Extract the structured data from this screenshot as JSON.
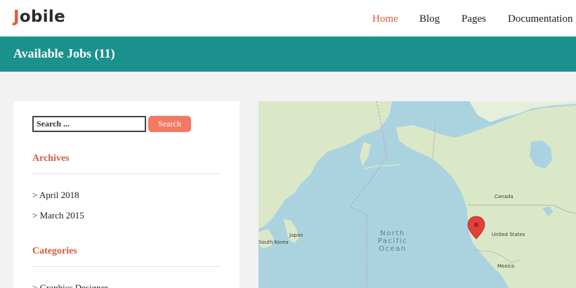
{
  "header": {
    "logo_first": "J",
    "logo_rest": "obile",
    "nav": [
      "Home",
      "Blog",
      "Pages",
      "Documentation"
    ]
  },
  "band": {
    "title": "Available Jobs (11)"
  },
  "sidebar": {
    "search": {
      "placeholder": "Search ...",
      "button": "Search"
    },
    "archives": {
      "title": "Archives",
      "items": [
        "April 2018",
        "March 2015"
      ]
    },
    "categories": {
      "title": "Categories",
      "items": [
        "Graphics Designer"
      ]
    },
    "bullet": ">"
  },
  "map": {
    "labels": {
      "canada": "Canada",
      "united_states": "United States",
      "mexico": "Mexico",
      "japan": "Japan",
      "south_korea": "South Korea",
      "ocean_line1": "North",
      "ocean_line2": "Pacific",
      "ocean_line3": "Ocean"
    }
  },
  "colors": {
    "accent": "#d45a3f",
    "band": "#1b918d",
    "button": "#f27a63",
    "water": "#aad3df",
    "land": "#dbe8c8",
    "marker": "#e3403a"
  }
}
